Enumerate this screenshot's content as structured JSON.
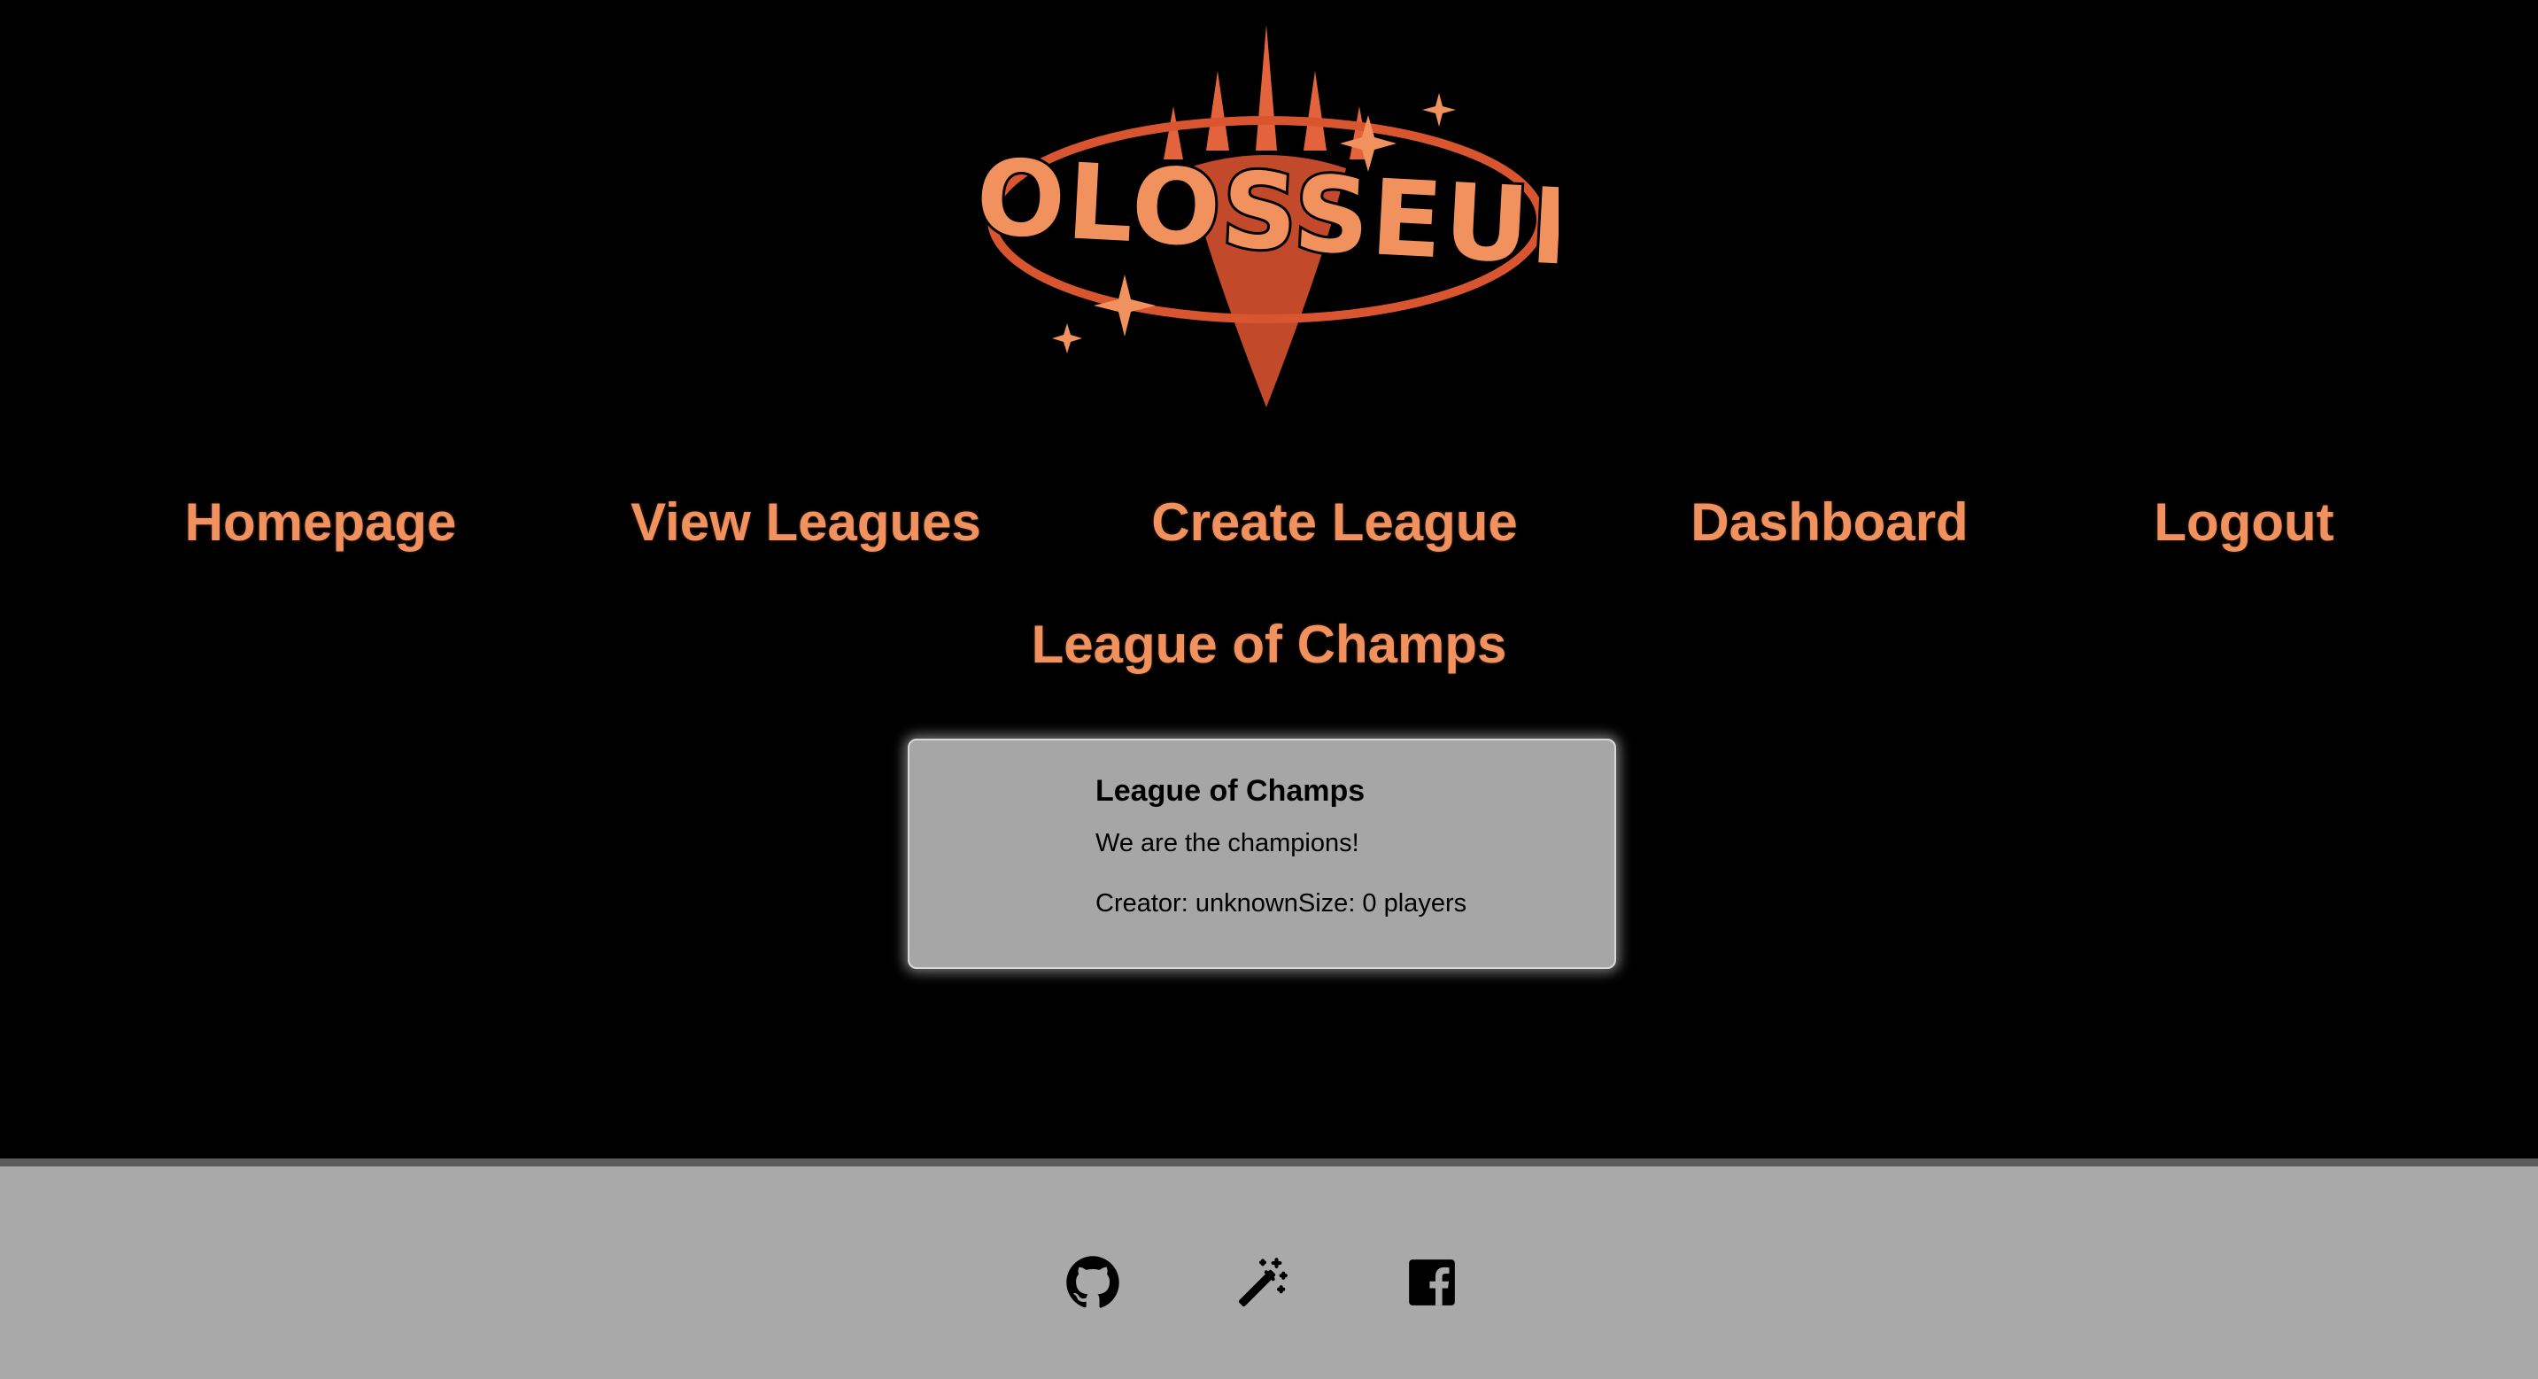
{
  "brand": {
    "logo_text": "COLOSSEUM",
    "logo_icon": "colosseum-logo",
    "accent_color": "#e3643c"
  },
  "nav": {
    "items": [
      {
        "label": "Homepage"
      },
      {
        "label": "View Leagues"
      },
      {
        "label": "Create League"
      },
      {
        "label": "Dashboard"
      },
      {
        "label": "Logout"
      }
    ],
    "link_color": "#f0915e"
  },
  "main": {
    "heading": "League of Champs",
    "card": {
      "title": "League of Champs",
      "description": "We are the champions!",
      "meta": "Creator: unknownSize: 0 players"
    }
  },
  "footer": {
    "icons": [
      "github-icon",
      "magic-wand-icon",
      "facebook-icon"
    ],
    "background": "#a9a9a9"
  }
}
